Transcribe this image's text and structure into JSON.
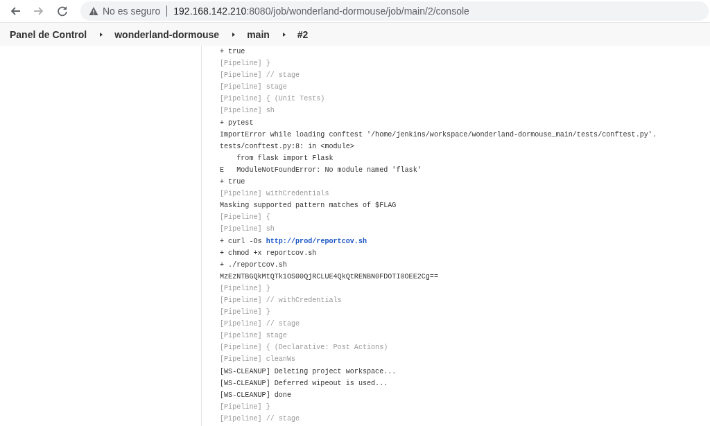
{
  "browser": {
    "back": {
      "disabled": false
    },
    "forward": {
      "disabled": true
    },
    "security": "No es seguro",
    "url_host": "192.168.142.210",
    "url_path": ":8080/job/wonderland-dormouse/job/main/2/console"
  },
  "breadcrumbs": [
    "Panel de Control",
    "wonderland-dormouse",
    "main",
    "#2"
  ],
  "console": [
    {
      "kind": "output",
      "text": "+ true"
    },
    {
      "kind": "pipeline",
      "text": "[Pipeline] }"
    },
    {
      "kind": "pipeline",
      "text": "[Pipeline] // stage"
    },
    {
      "kind": "pipeline",
      "text": "[Pipeline] stage"
    },
    {
      "kind": "pipeline",
      "text": "[Pipeline] { (Unit Tests)"
    },
    {
      "kind": "pipeline",
      "text": "[Pipeline] sh"
    },
    {
      "kind": "output",
      "text": "+ pytest"
    },
    {
      "kind": "output",
      "text": "ImportError while loading conftest '/home/jenkins/workspace/wonderland-dormouse_main/tests/conftest.py'."
    },
    {
      "kind": "output",
      "text": "tests/conftest.py:8: in <module>"
    },
    {
      "kind": "output",
      "text": "    from flask import Flask"
    },
    {
      "kind": "output",
      "text": "E   ModuleNotFoundError: No module named 'flask'"
    },
    {
      "kind": "output",
      "text": "+ true"
    },
    {
      "kind": "pipeline",
      "text": "[Pipeline] withCredentials"
    },
    {
      "kind": "output",
      "text": "Masking supported pattern matches of $FLAG"
    },
    {
      "kind": "pipeline",
      "text": "[Pipeline] {"
    },
    {
      "kind": "pipeline",
      "text": "[Pipeline] sh"
    },
    {
      "kind": "link",
      "text": "+ curl -Os ",
      "link": "http://prod/reportcov.sh"
    },
    {
      "kind": "output",
      "text": "+ chmod +x reportcov.sh"
    },
    {
      "kind": "output",
      "text": "+ ./reportcov.sh"
    },
    {
      "kind": "output",
      "text": "MzEzNTBGQkMtQTk1OS00QjRCLUE4QkQtRENBN0FDOTI0OEE2Cg=="
    },
    {
      "kind": "pipeline",
      "text": "[Pipeline] }"
    },
    {
      "kind": "pipeline",
      "text": "[Pipeline] // withCredentials"
    },
    {
      "kind": "pipeline",
      "text": "[Pipeline] }"
    },
    {
      "kind": "pipeline",
      "text": "[Pipeline] // stage"
    },
    {
      "kind": "pipeline",
      "text": "[Pipeline] stage"
    },
    {
      "kind": "pipeline",
      "text": "[Pipeline] { (Declarative: Post Actions)"
    },
    {
      "kind": "pipeline",
      "text": "[Pipeline] cleanWs"
    },
    {
      "kind": "output",
      "text": "[WS-CLEANUP] Deleting project workspace..."
    },
    {
      "kind": "output",
      "text": "[WS-CLEANUP] Deferred wipeout is used..."
    },
    {
      "kind": "output",
      "text": "[WS-CLEANUP] done"
    },
    {
      "kind": "pipeline",
      "text": "[Pipeline] }"
    },
    {
      "kind": "pipeline",
      "text": "[Pipeline] // stage"
    }
  ]
}
